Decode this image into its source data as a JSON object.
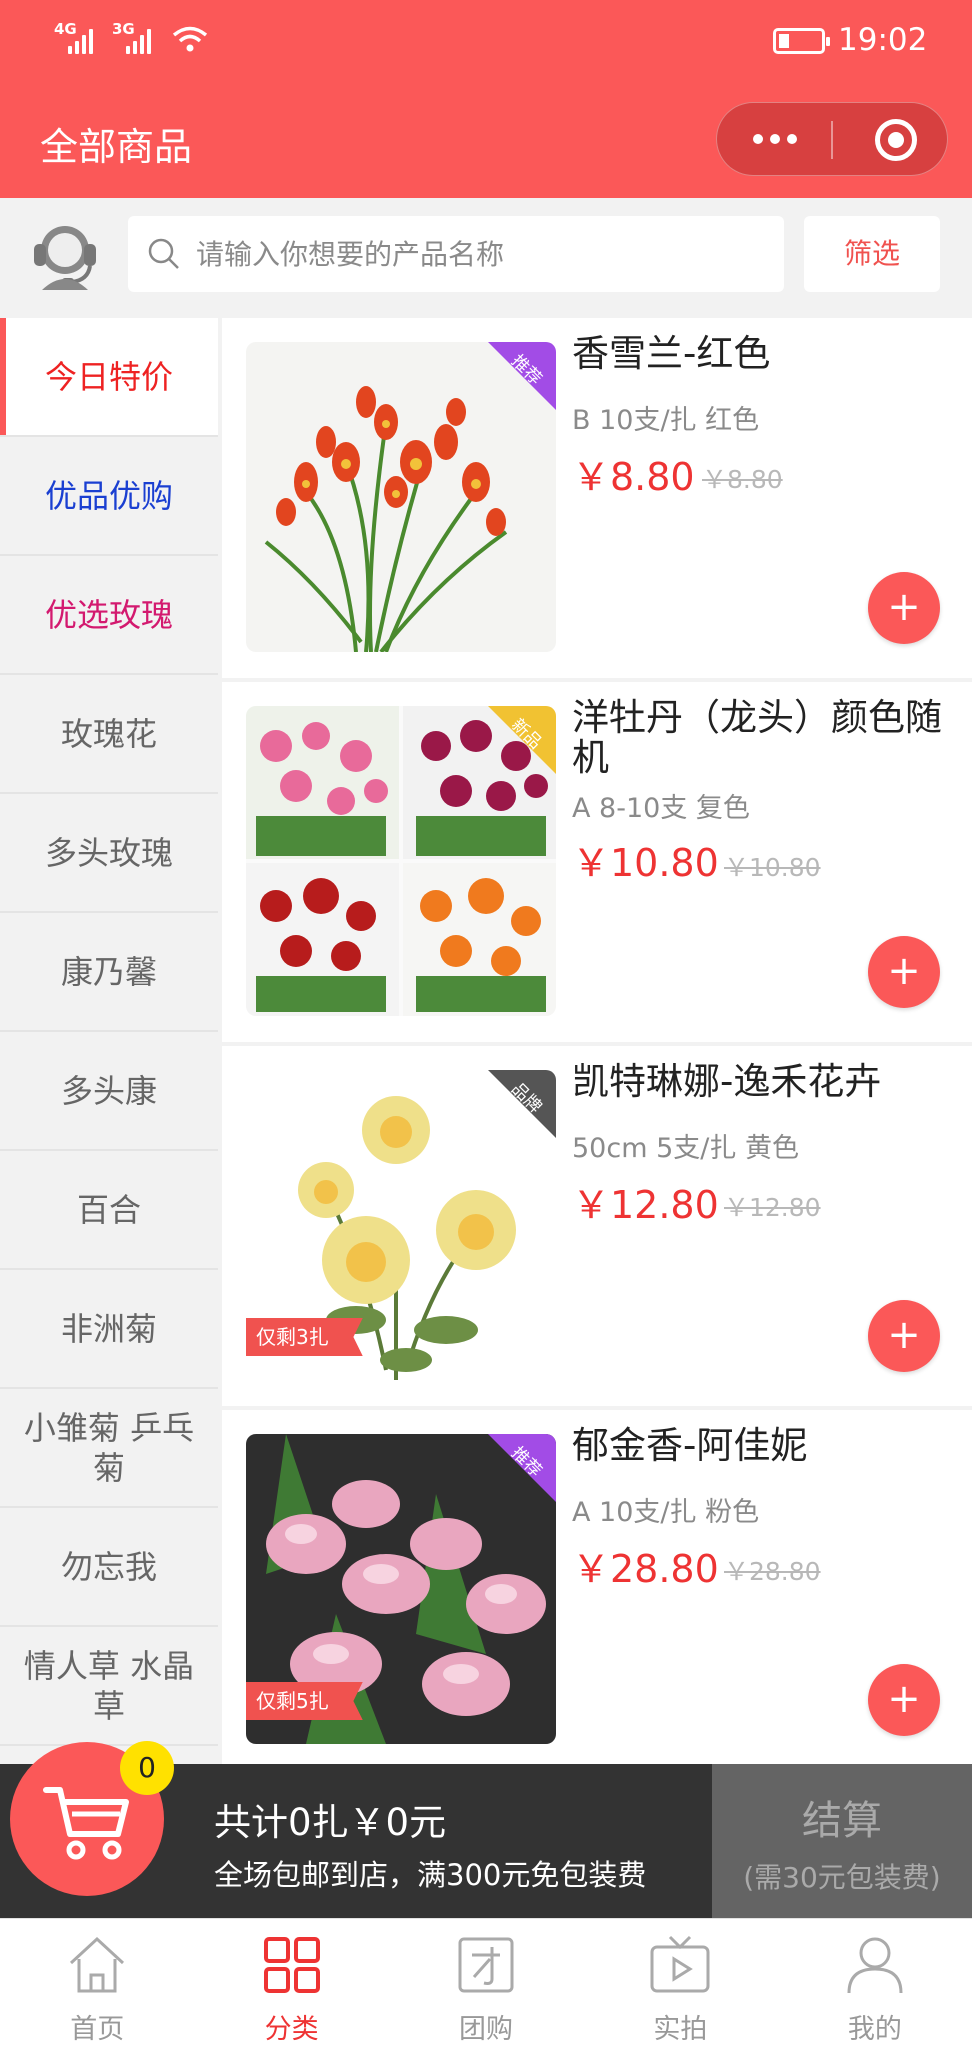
{
  "status_bar": {
    "signal_1": "4G",
    "signal_2": "3G",
    "time": "19:02"
  },
  "header": {
    "title": "全部商品"
  },
  "search": {
    "placeholder": "请输入你想要的产品名称",
    "filter_label": "筛选"
  },
  "sidebar": {
    "items": [
      {
        "label": "今日特价",
        "color": "#ee2222",
        "active": true
      },
      {
        "label": "优品优购",
        "color": "#1a3fd1"
      },
      {
        "label": "优选玫瑰",
        "color": "#d3196f"
      },
      {
        "label": "玫瑰花"
      },
      {
        "label": "多头玫瑰"
      },
      {
        "label": "康乃馨"
      },
      {
        "label": "多头康"
      },
      {
        "label": "百合"
      },
      {
        "label": "非洲菊"
      },
      {
        "label": "小雏菊 乒乓菊"
      },
      {
        "label": "勿忘我"
      },
      {
        "label": "情人草 水晶草"
      }
    ]
  },
  "products": [
    {
      "name": "香雪兰-红色",
      "spec": "B 10支/扎 红色",
      "price": "￥8.80",
      "old_price": "￥8.80",
      "tag": "推荐",
      "tag_color": "#a24ce6",
      "stock": ""
    },
    {
      "name": "洋牡丹（龙头）颜色随机",
      "spec": "A 8-10支 复色",
      "price": "￥10.80",
      "old_price": "￥10.80",
      "tag": "新品",
      "tag_color": "#f1c232",
      "stock": ""
    },
    {
      "name": "凯特琳娜-逸禾花卉",
      "spec": "50cm 5支/扎 黄色",
      "price": "￥12.80",
      "old_price": "￥12.80",
      "tag": "品牌",
      "tag_color": "#555555",
      "stock": "仅剩3扎"
    },
    {
      "name": "郁金香-阿佳妮",
      "spec": "A 10支/扎 粉色",
      "price": "￥28.80",
      "old_price": "￥28.80",
      "tag": "推荐",
      "tag_color": "#a24ce6",
      "stock": "仅剩5扎"
    }
  ],
  "cart": {
    "count": "0",
    "total": "共计0扎￥0元",
    "note": "全场包邮到店，满300元免包装费",
    "checkout_label": "结算",
    "checkout_note": "(需30元包装费)"
  },
  "tabbar": {
    "items": [
      {
        "label": "首页",
        "icon": "home-icon"
      },
      {
        "label": "分类",
        "icon": "category-icon",
        "active": true
      },
      {
        "label": "团购",
        "icon": "group-buy-icon"
      },
      {
        "label": "实拍",
        "icon": "video-icon"
      },
      {
        "label": "我的",
        "icon": "profile-icon"
      }
    ]
  },
  "colors": {
    "brand": "#fb5858",
    "price": "#ee3333",
    "cart_bar": "#333333",
    "badge": "#ffe100"
  }
}
